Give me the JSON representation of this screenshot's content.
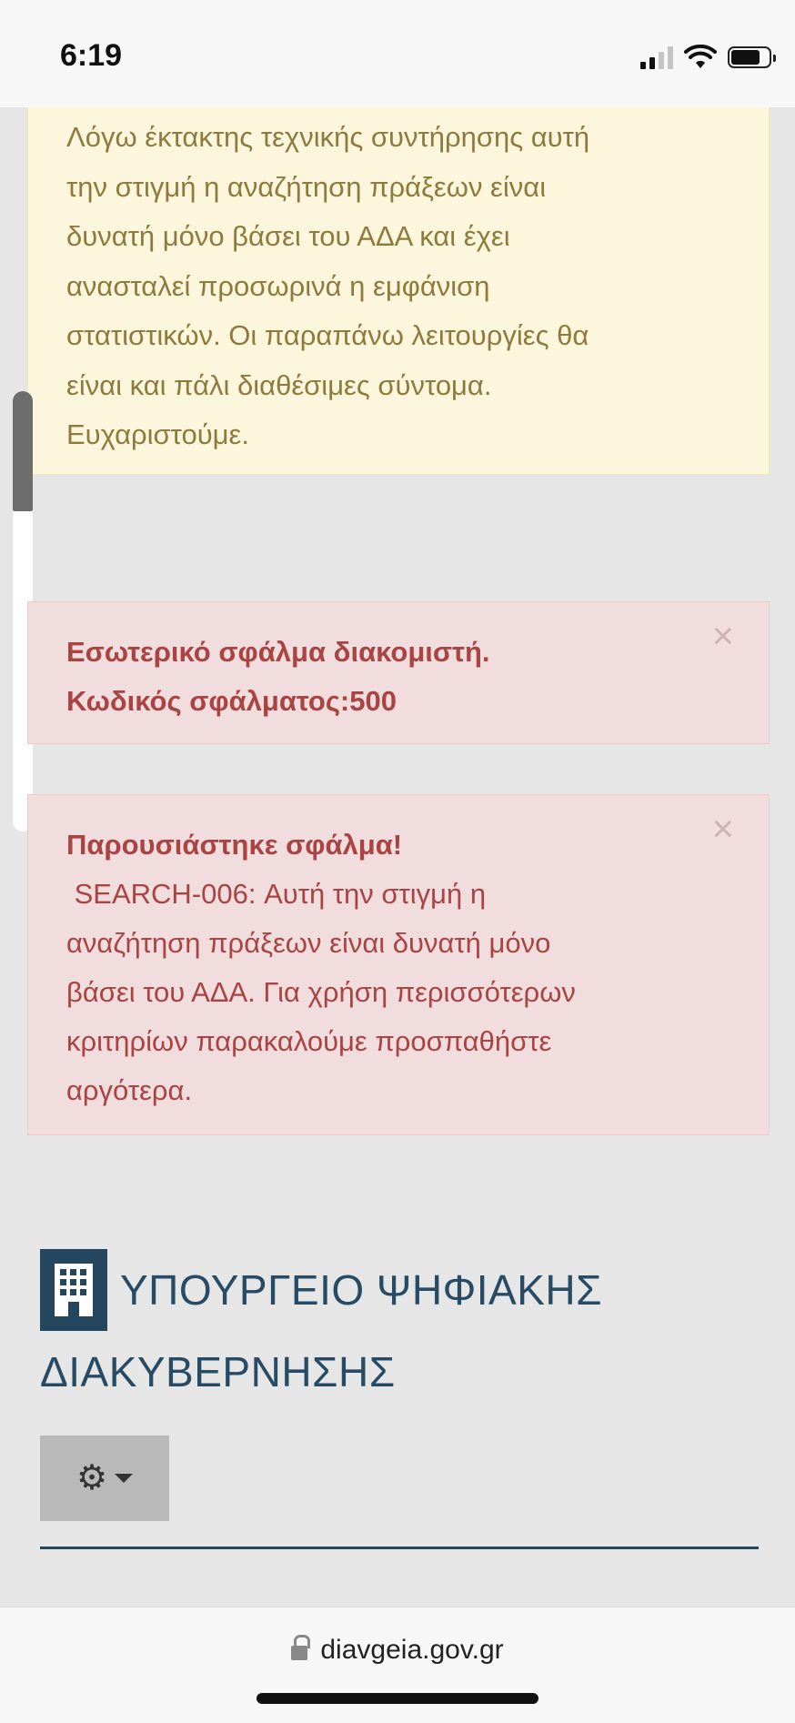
{
  "status_bar": {
    "time": "6:19"
  },
  "notice": {
    "lines": [
      "Λόγω έκτακτης τεχνικής συντήρησης αυτή",
      "την στιγμή η αναζήτηση πράξεων είναι",
      "δυνατή μόνο βάσει του ΑΔΑ και έχει",
      "ανασταλεί προσωρινά η εμφάνιση",
      "στατιστικών. Οι παραπάνω λειτουργίες θα",
      "είναι και πάλι διαθέσιμες σύντομα.",
      "Ευχαριστούμε."
    ]
  },
  "alerts": [
    {
      "title": "Εσωτερικό σφάλμα διακομιστή.",
      "code": "Κωδικός σφάλματος:500",
      "close": "×"
    },
    {
      "title": "Παρουσιάστηκε σφάλμα!",
      "body_lines": [
        " SEARCH-006: Αυτή την στιγμή η",
        "αναζήτηση πράξεων είναι δυνατή μόνο",
        "βάσει του ΑΔΑ. Για χρήση περισσότερων",
        "κριτηρίων παρακαλούμε προσπαθήστε",
        "αργότερα."
      ],
      "close": "×"
    }
  ],
  "brand": {
    "line1": "ΥΠΟΥΡΓΕΙΟ ΨΗΦΙΑΚΗΣ",
    "line2": "ΔΙΑΚΥΒΕΡΝΗΣΗΣ",
    "icon": "building-icon"
  },
  "settings": {
    "icon": "gear-icon",
    "caret": "caret-down-icon"
  },
  "browser": {
    "url": "diavgeia.gov.gr"
  },
  "colors": {
    "notice_bg": "#fcf7dc",
    "notice_text": "#8f7a3d",
    "alert_bg": "#f1dcde",
    "alert_text": "#a94442",
    "brand": "#274b64"
  }
}
